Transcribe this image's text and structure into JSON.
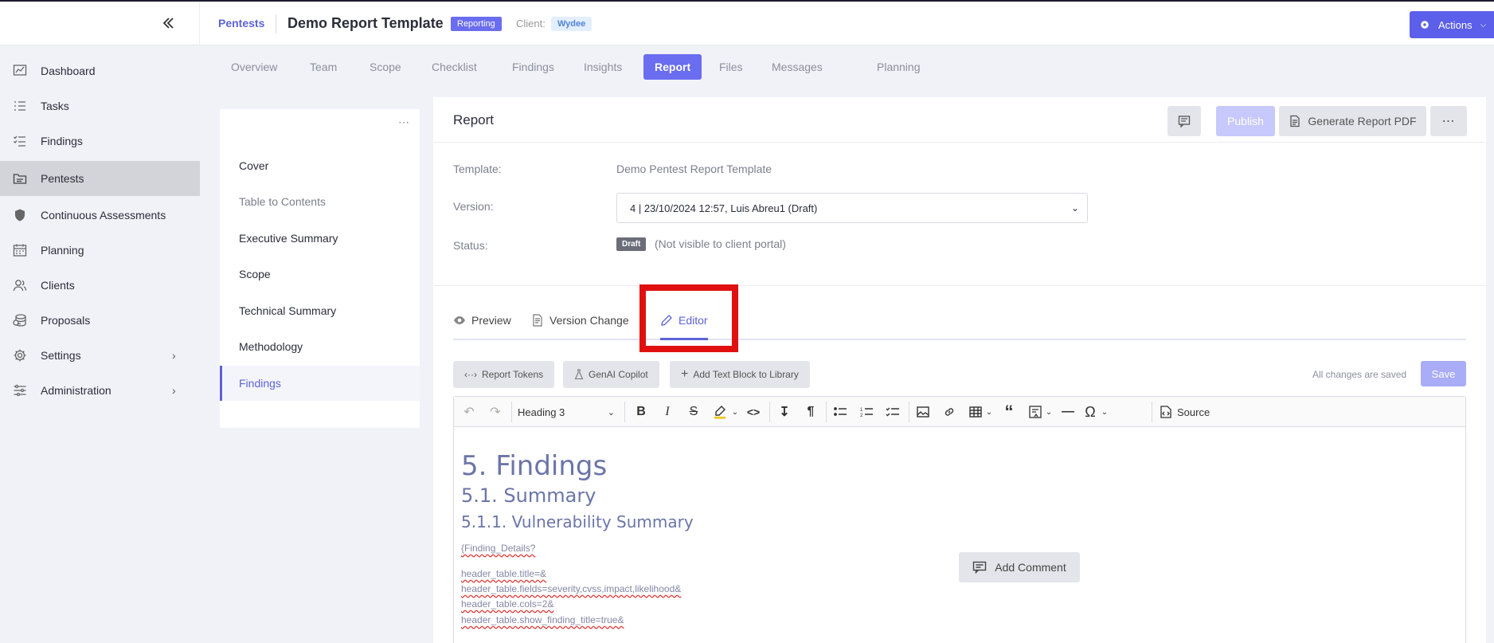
{
  "header": {
    "breadcrumb": "Pentests",
    "title": "Demo Report Template",
    "status_tag": "Reporting",
    "client_label": "Client:",
    "client_name": "Wydee",
    "actions_label": "Actions"
  },
  "sidebar": {
    "items": [
      {
        "label": "Dashboard",
        "icon": "chart-icon"
      },
      {
        "label": "Tasks",
        "icon": "list-icon"
      },
      {
        "label": "Findings",
        "icon": "checklist-icon"
      },
      {
        "label": "Pentests",
        "icon": "folder-icon"
      },
      {
        "label": "Continuous Assessments",
        "icon": "shield-icon"
      },
      {
        "label": "Planning",
        "icon": "calendar-icon"
      },
      {
        "label": "Clients",
        "icon": "users-icon"
      },
      {
        "label": "Proposals",
        "icon": "coins-icon"
      },
      {
        "label": "Settings",
        "icon": "gear-icon"
      },
      {
        "label": "Administration",
        "icon": "sliders-icon"
      }
    ]
  },
  "tabs": [
    "Overview",
    "Team",
    "Scope",
    "Checklist",
    "Findings",
    "Insights",
    "Report",
    "Files",
    "Messages",
    "Planning"
  ],
  "sections": [
    "Cover",
    "Table to Contents",
    "Executive Summary",
    "Scope",
    "Technical Summary",
    "Methodology",
    "Findings"
  ],
  "report": {
    "title": "Report",
    "publish_label": "Publish",
    "generate_label": "Generate Report PDF",
    "template_label": "Template:",
    "template_value": "Demo Pentest Report Template",
    "version_label": "Version:",
    "version_value": "4 | 23/10/2024 12:57, Luis Abreu1 (Draft)",
    "status_label": "Status:",
    "status_badge": "Draft",
    "status_note": "(Not visible to client portal)"
  },
  "editor_tabs": {
    "preview": "Preview",
    "version_changes": "Version Change",
    "editor": "Editor"
  },
  "editor_tools": {
    "report_tokens": "Report Tokens",
    "genai": "GenAI Copilot",
    "add_block": "Add Text Block to Library",
    "saved_note": "All changes are saved",
    "save_label": "Save",
    "heading_value": "Heading 3",
    "source_label": "Source"
  },
  "content": {
    "h1": "5. Findings",
    "h2": "5.1. Summary",
    "h3": "5.1.1. Vulnerability Summary",
    "lines": [
      "{Finding_Details?",
      "header_table.title=&",
      "header_table.fields=severity,cvss,impact,likelihood&",
      "header_table.cols=2&",
      "header_table.show_finding_title=true&"
    ],
    "comment_label": "Add Comment"
  },
  "colors": {
    "accent": "#6a6df0",
    "highlight": "#e01010"
  }
}
